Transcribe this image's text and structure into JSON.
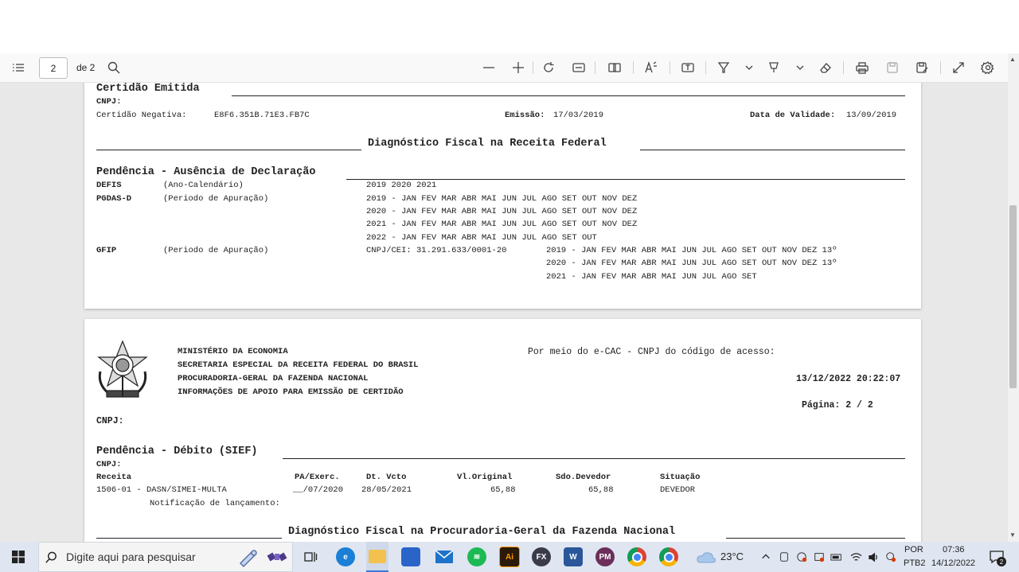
{
  "toolbar": {
    "page_number": "2",
    "page_total": "de 2"
  },
  "page1": {
    "certidao_emitida": "Certidão Emitida",
    "cnpj_label": "CNPJ:",
    "certidao_negativa_label": "Certidão Negativa:",
    "certidao_negativa_value": "E8F6.351B.71E3.FB7C",
    "emissao_label": "Emissão:",
    "emissao_value": "17/03/2019",
    "validade_label": "Data de Validade:",
    "validade_value": "13/09/2019",
    "diag_receita_title": "Diagnóstico Fiscal na Receita Federal",
    "pendencia_ausencia_title": "Pendência - Ausência de Declaração",
    "rows": [
      {
        "code": "DEFIS",
        "desc": "(Ano-Calendário)",
        "detail": "2019 2020 2021"
      },
      {
        "code": "PGDAS-D",
        "desc": "(Periodo de Apuração)",
        "detail": "2019 - JAN FEV MAR ABR MAI JUN JUL AGO SET OUT NOV DEZ"
      },
      {
        "code": "",
        "desc": "",
        "detail": "2020 - JAN FEV MAR ABR MAI JUN JUL AGO SET OUT NOV DEZ"
      },
      {
        "code": "",
        "desc": "",
        "detail": "2021 - JAN FEV MAR ABR MAI JUN JUL AGO SET OUT NOV DEZ"
      },
      {
        "code": "",
        "desc": "",
        "detail": "2022 - JAN FEV MAR ABR MAI JUN JUL AGO SET OUT"
      },
      {
        "code": "GFIP",
        "desc": "(Periodo de Apuração)",
        "detail": "CNPJ/CEI: 31.291.633/0001-20"
      }
    ],
    "gfip_lines": [
      "2019 - JAN FEV MAR ABR MAI JUN JUL AGO SET OUT NOV DEZ 13º",
      "2020 - JAN FEV MAR ABR MAI JUN JUL AGO SET OUT NOV DEZ 13º",
      "2021 - JAN FEV MAR ABR MAI JUN JUL AGO SET"
    ]
  },
  "page2": {
    "header_lines": [
      "MINISTÉRIO DA ECONOMIA",
      "SECRETARIA ESPECIAL DA RECEITA FEDERAL DO BRASIL",
      "PROCURADORIA-GERAL DA FAZENDA NACIONAL",
      "INFORMAÇÕES DE APOIO PARA EMISSÃO DE CERTIDÃO"
    ],
    "ecac_text": "Por meio do e-CAC - CNPJ do código de acesso:",
    "datetime": "13/12/2022 20:22:07",
    "pagina": "Página: 2 / 2",
    "cnpj_label": "CNPJ:",
    "pendencia_debito_title": "Pendência - Débito (SIEF)",
    "cnpj_label2": "CNPJ:",
    "table_headers": [
      "Receita",
      "PA/Exerc.",
      "Dt. Vcto",
      "Vl.Original",
      "Sdo.Devedor",
      "Situação"
    ],
    "table_row": [
      "1506-01 - DASN/SIMEI-MULTA",
      "__/07/2020",
      "28/05/2021",
      "65,88",
      "65,88",
      "DEVEDOR"
    ],
    "notificacao": "Notificação de lançamento:",
    "diag_pgfn_title": "Diagnóstico Fiscal na Procuradoria-Geral da Fazenda Nacional"
  },
  "taskbar": {
    "search_placeholder": "Digite aqui para pesquisar",
    "weather": "23°C",
    "lang_top": "POR",
    "lang_bottom": "PTB2",
    "time": "07:36",
    "date": "14/12/2022",
    "notif_count": "2",
    "ai_label": "Ai",
    "fx_label": "FX",
    "word_label": "W",
    "pm_label": "PM"
  }
}
